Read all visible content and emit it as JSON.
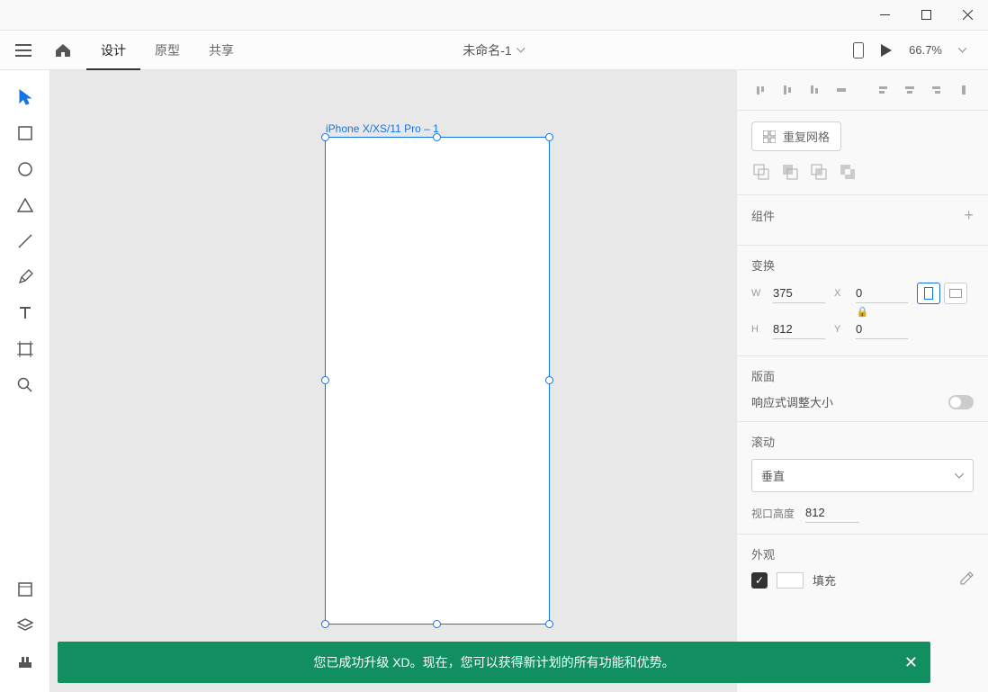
{
  "titlebar": {},
  "topbar": {
    "tabs": {
      "design": "设计",
      "prototype": "原型",
      "share": "共享"
    },
    "doc_title": "未命名-1",
    "zoom": "66.7%"
  },
  "canvas": {
    "artboard_name": "iPhone X/XS/11 Pro – 1"
  },
  "panel": {
    "repeat_grid": "重复网格",
    "component_header": "组件",
    "transform": {
      "header": "变换",
      "w_label": "W",
      "w_value": "375",
      "h_label": "H",
      "h_value": "812",
      "x_label": "X",
      "x_value": "0",
      "y_label": "Y",
      "y_value": "0"
    },
    "layout": {
      "header": "版面",
      "responsive": "响应式调整大小"
    },
    "scroll": {
      "header": "滚动",
      "mode": "垂直",
      "viewport_label": "视口高度",
      "viewport_value": "812"
    },
    "appearance": {
      "header": "外观",
      "fill_label": "填充"
    }
  },
  "notification": {
    "message": "您已成功升级 XD。现在，您可以获得新计划的所有功能和优势。"
  }
}
